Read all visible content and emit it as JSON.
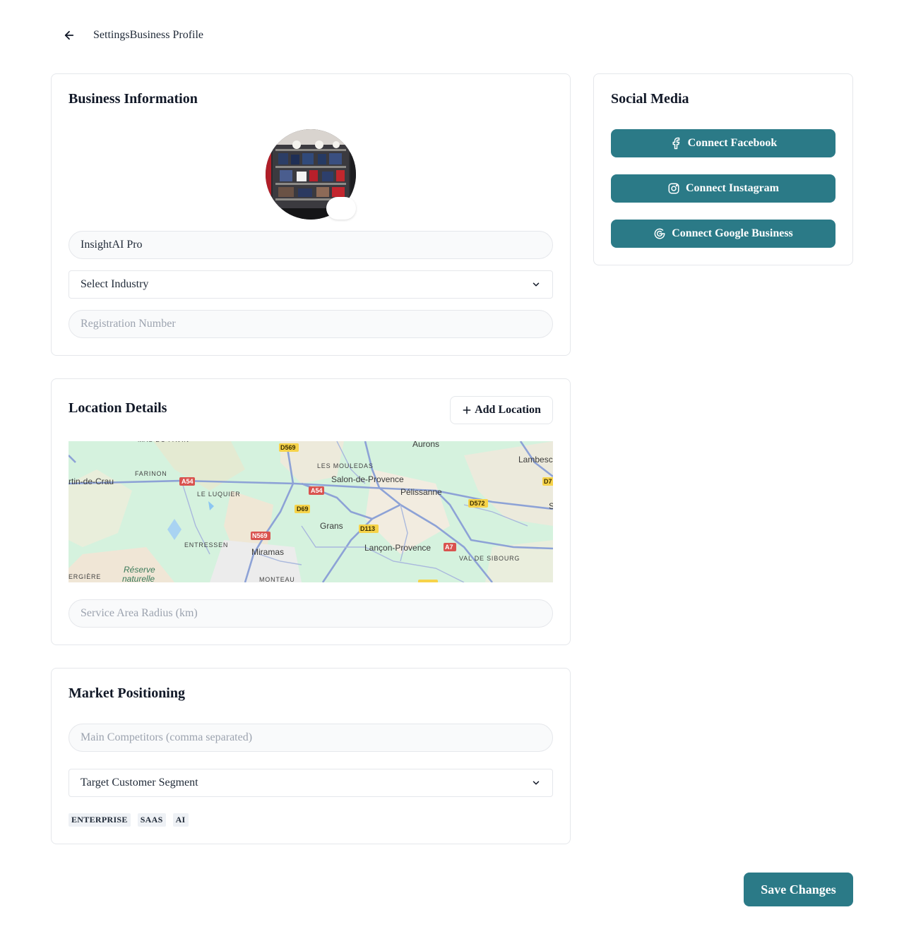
{
  "header": {
    "breadcrumb": "SettingsBusiness Profile"
  },
  "business_info": {
    "title": "Business Information",
    "business_name_value": "InsightAI Pro",
    "industry_select": "Select Industry",
    "registration_placeholder": "Registration Number"
  },
  "social": {
    "title": "Social Media",
    "buttons": [
      {
        "label": "Connect Facebook",
        "icon": "facebook-icon"
      },
      {
        "label": "Connect Instagram",
        "icon": "instagram-icon"
      },
      {
        "label": "Connect Google Business",
        "icon": "google-icon"
      }
    ]
  },
  "location": {
    "title": "Location Details",
    "add_label": "Add Location",
    "radius_placeholder": "Service Area Radius (km)",
    "map": {
      "places": [
        "Aurons",
        "Lambesc",
        "LES MOULEDAS",
        "FARINON",
        "Salon-de-Provence",
        "Pélissanne",
        "rtin-de-Crau",
        "LE LUQUIER",
        "Grans",
        "ENTRESSEN",
        "Miramas",
        "Lançon-Provence",
        "VAL DE SIBOURG",
        "Réserve",
        "naturelle",
        "ERGIÈRE",
        "MONTEAU",
        "MAS DU PAVIN"
      ],
      "roads": [
        "D569",
        "A54",
        "A54",
        "D69",
        "D572",
        "D113",
        "N569",
        "A7",
        "D7",
        "S"
      ]
    }
  },
  "market": {
    "title": "Market Positioning",
    "competitors_placeholder": "Main Competitors (comma separated)",
    "segment_select": "Target Customer Segment",
    "tags": [
      "ENTERPRISE",
      "SAAS",
      "AI"
    ]
  },
  "actions": {
    "save_label": "Save Changes"
  },
  "colors": {
    "accent": "#2b7a87",
    "border": "#e5e7eb",
    "input_bg": "#f9fafb"
  }
}
